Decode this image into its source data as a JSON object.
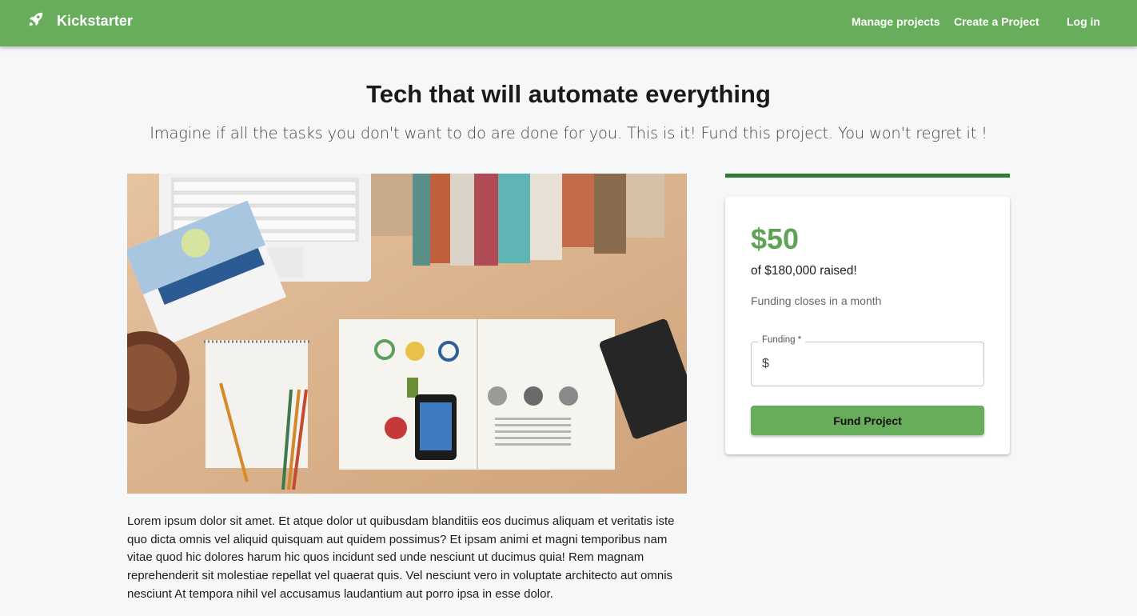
{
  "header": {
    "brand_icon": "rocket-icon",
    "brand_name": "Kickstarter",
    "nav": [
      "Manage projects",
      "Create a Project",
      "Log in"
    ],
    "bar_color": "#67ad5b"
  },
  "project": {
    "title": "Tech that will automate everything",
    "subtitle": "Imagine if all the tasks you don't want to do are done for you. This is it! Fund this project. You won't regret it !",
    "description": "Lorem ipsum dolor sit amet. Et atque dolor ut quibusdam blanditiis eos ducimus aliquam et veritatis iste quo dicta omnis vel aliquid quisquam aut quidem possimus? Et ipsam animi et magni temporibus nam vitae quod hic dolores harum hic quos incidunt sed unde nesciunt ut ducimus quia! Rem magnam reprehenderit sit molestiae repellat vel quaerat quis. Vel nesciunt vero in voluptate architecto aut omnis nesciunt At tempora nihil vel accusamus laudantium aut porro ipsa in esse dolor."
  },
  "funding": {
    "progress_fraction": 1.0,
    "raised": "$50",
    "goal_text": "of $180,000 raised!",
    "closes_text": "Funding closes in a month",
    "field_label": "Funding *",
    "field_prefix": "$",
    "field_value": "",
    "button_label": "Fund Project",
    "accent_color": "#5fa356",
    "progress_color": "#2f7d32"
  }
}
